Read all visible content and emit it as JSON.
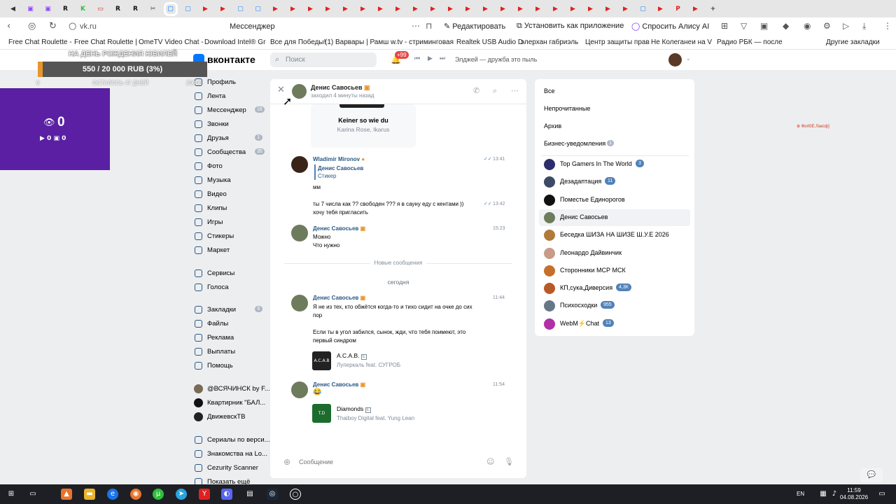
{
  "browser": {
    "tab_icons": [
      {
        "name": "back-tab-icon",
        "glyph": "◀",
        "color": "#333333"
      },
      {
        "name": "twitch-tab-icon",
        "glyph": "▣",
        "color": "#9146ff"
      },
      {
        "name": "twitch-tab-icon",
        "glyph": "▣",
        "color": "#9146ff"
      },
      {
        "name": "r-tab-icon",
        "glyph": "R",
        "color": "#111111"
      },
      {
        "name": "kick-tab-icon",
        "glyph": "K",
        "color": "#2fbf3c"
      },
      {
        "name": "video-tab-icon",
        "glyph": "▭",
        "color": "#e02020"
      },
      {
        "name": "r-tab-icon",
        "glyph": "R",
        "color": "#111111"
      },
      {
        "name": "r-tab-icon",
        "glyph": "R",
        "color": "#111111"
      },
      {
        "name": "scissors-tab-icon",
        "glyph": "✂",
        "color": "#444444"
      },
      {
        "name": "vk-tab-icon",
        "glyph": "▢",
        "color": "#0077ff",
        "active": true
      },
      {
        "name": "messenger-tab-icon",
        "glyph": "▢",
        "color": "#2787f5"
      },
      {
        "name": "youtube-tab-icon",
        "glyph": "▶",
        "color": "#e02020"
      },
      {
        "name": "youtube-tab-icon",
        "glyph": "▶",
        "color": "#e02020"
      },
      {
        "name": "messenger-tab-icon",
        "glyph": "▢",
        "color": "#2787f5"
      },
      {
        "name": "messenger-tab-icon",
        "glyph": "▢",
        "color": "#2787f5"
      },
      {
        "name": "youtube-tab-icon",
        "glyph": "▶",
        "color": "#e02020"
      },
      {
        "name": "youtube-tab-icon",
        "glyph": "▶",
        "color": "#e02020"
      },
      {
        "name": "youtube-tab-icon",
        "glyph": "▶",
        "color": "#e02020"
      },
      {
        "name": "youtube-tab-icon",
        "glyph": "▶",
        "color": "#e02020"
      },
      {
        "name": "youtube-tab-icon",
        "glyph": "▶",
        "color": "#e02020"
      },
      {
        "name": "youtube-tab-icon",
        "glyph": "▶",
        "color": "#e02020"
      },
      {
        "name": "youtube-tab-icon",
        "glyph": "▶",
        "color": "#e02020"
      },
      {
        "name": "youtube-tab-icon",
        "glyph": "▶",
        "color": "#e02020"
      },
      {
        "name": "youtube-tab-icon",
        "glyph": "▶",
        "color": "#e02020"
      },
      {
        "name": "youtube-tab-icon",
        "glyph": "▶",
        "color": "#e02020"
      },
      {
        "name": "youtube-tab-icon",
        "glyph": "▶",
        "color": "#e02020"
      },
      {
        "name": "youtube-tab-icon",
        "glyph": "▶",
        "color": "#e02020"
      },
      {
        "name": "youtube-tab-icon",
        "glyph": "▶",
        "color": "#e02020"
      },
      {
        "name": "youtube-tab-icon",
        "glyph": "▶",
        "color": "#e02020"
      },
      {
        "name": "youtube-tab-icon",
        "glyph": "▶",
        "color": "#e02020"
      },
      {
        "name": "youtube-tab-icon",
        "glyph": "▶",
        "color": "#e02020"
      },
      {
        "name": "youtube-tab-icon",
        "glyph": "▶",
        "color": "#e02020"
      },
      {
        "name": "youtube-tab-icon",
        "glyph": "▶",
        "color": "#e02020"
      },
      {
        "name": "youtube-tab-icon",
        "glyph": "▶",
        "color": "#e02020"
      },
      {
        "name": "youtube-tab-icon",
        "glyph": "▶",
        "color": "#e02020"
      },
      {
        "name": "youtube-tab-icon",
        "glyph": "▶",
        "color": "#e02020"
      },
      {
        "name": "messenger-tab-icon",
        "glyph": "▢",
        "color": "#2787f5"
      },
      {
        "name": "youtube-tab-icon",
        "glyph": "▶",
        "color": "#e02020"
      },
      {
        "name": "p-tab-icon",
        "glyph": "P",
        "color": "#e02020"
      },
      {
        "name": "youtube-tab-icon",
        "glyph": "▶",
        "color": "#e02020"
      }
    ],
    "new_tab": "+",
    "url": "vk.ru",
    "page_title": "Мессенджер",
    "edit_label": "Редактировать",
    "install_label": "Установить как приложение",
    "alice_label": "Спросить Алису AI",
    "bookmarks": [
      "Free Chat Roulette -",
      "Free Chat Roulette |",
      "OmeTV Video Chat -",
      "Download Intel® Gr",
      "Все для Победы!",
      "(1) Варвары | Рамш",
      "w.tv - стриминговая",
      "Realtek USB Audio D",
      "элерхан габриэль",
      "Центр защиты прав",
      "Не Колеганеи на V",
      "Радио РБК — после"
    ],
    "other_bookmarks": "Другие закладки"
  },
  "vk": {
    "logo_text": "вконтакте",
    "search_placeholder": "Поиск",
    "notif_badge": "+99",
    "track": "Элджей — дружба это пыль"
  },
  "sidebar": {
    "items": [
      {
        "label": "Профиль",
        "count": ""
      },
      {
        "label": "Лента",
        "count": ""
      },
      {
        "label": "Мессенджер",
        "count": "16"
      },
      {
        "label": "Звонки",
        "count": ""
      },
      {
        "label": "Друзья",
        "count": "1"
      },
      {
        "label": "Сообщества",
        "count": "35"
      },
      {
        "label": "Фото",
        "count": ""
      },
      {
        "label": "Музыка",
        "count": ""
      },
      {
        "label": "Видео",
        "count": ""
      },
      {
        "label": "Клипы",
        "count": ""
      },
      {
        "label": "Игры",
        "count": ""
      },
      {
        "label": "Стикеры",
        "count": ""
      },
      {
        "label": "Маркет",
        "count": ""
      },
      {
        "label": "Сервисы",
        "count": ""
      },
      {
        "label": "Голоса",
        "count": ""
      },
      {
        "label": "Закладки",
        "count": "6"
      },
      {
        "label": "Файлы",
        "count": ""
      },
      {
        "label": "Реклама",
        "count": ""
      },
      {
        "label": "Выплаты",
        "count": ""
      },
      {
        "label": "Помощь",
        "count": ""
      }
    ],
    "groups": [
      {
        "label": "@ВСЯЧИНСК by F...",
        "color": "#7a6a58"
      },
      {
        "label": "Квартирник \"БАЛ...",
        "color": "#111111"
      },
      {
        "label": "ДвижевскТВ",
        "color": "#222222"
      }
    ],
    "apps": [
      {
        "label": "Сериалы по верси..."
      },
      {
        "label": "Знакомства на Lo..."
      },
      {
        "label": "Cezurity Scanner"
      },
      {
        "label": "Показать ещё"
      }
    ]
  },
  "chat": {
    "name": "Денис Савосьев",
    "status": "заходил 4 минуты назад",
    "top_track": {
      "title": "Keiner so wie du",
      "artist": "Karina Rose, Ikarus"
    },
    "wladimir": {
      "name": "Wladimir Mironov",
      "reply_to": "Денис Савосьев",
      "reply_text": "Стикер",
      "msg1": "мм",
      "time1": "13:41",
      "msg2": "ты 7 числа как ?? свободен ??? я в сауну еду с кентами ))",
      "msg3": "хочу тебя пригласить",
      "time2": "13:42"
    },
    "denis1": {
      "name": "Денис Савосьев",
      "time": "15:23",
      "line1": "Можно",
      "line2": "Что нужно"
    },
    "new_messages": "Новые сообщения",
    "today": "сегодня",
    "denis2": {
      "name": "Денис Савосьев",
      "time": "11:44",
      "p1a": "Я не из тех, кто обжётся когда-то и тихо сидит на очке до сих",
      "p1b": "пор",
      "p2a": "Если ты в угол забился, сынок, жди, что тебя поимеют, это",
      "p2b": "первый синдром",
      "track_title": "A.C.A.B.",
      "track_artist": "Луперкаль feat. СУГРОБ",
      "explicit": "E",
      "cover": "A.C.A.B"
    },
    "denis3": {
      "name": "Денис Савосьев",
      "time": "11:54",
      "emoji": "😂",
      "track_title": "Diamonds",
      "track_artist": "Thaiboy Digital feat. Yung Lean",
      "explicit": "E",
      "cover": "T.D"
    },
    "composer_placeholder": "Сообщение"
  },
  "filters": {
    "all": "Все",
    "unread": "Непрочитанные",
    "archive": "Архив",
    "business": "Бизнес-уведомления",
    "business_count": "1"
  },
  "conversations": [
    {
      "name": "Top Gamers In The World",
      "badge": "3",
      "color": "#2d2d6b"
    },
    {
      "name": "Дезадаптация",
      "badge": "11",
      "color": "#3c4a64"
    },
    {
      "name": "Поместье Единорогов",
      "badge": "",
      "color": "#111111"
    },
    {
      "name": "Денис Савосьев",
      "badge": "",
      "color": "#6e7b5d",
      "active": true
    },
    {
      "name": "Беседка ШИЗА НА ШИЗЕ Ш.У.Е 2026",
      "badge": "",
      "color": "#b07a3a"
    },
    {
      "name": "Леонардо Дайвинчик",
      "badge": "",
      "color": "#c89a8a"
    },
    {
      "name": "Сторонники МСР МСК",
      "badge": "",
      "color": "#c4702a"
    },
    {
      "name": "КП,сука,Диверсия",
      "badge": "4,3К",
      "color": "#b85a28"
    },
    {
      "name": "Психосходки",
      "badge": "955",
      "color": "#667788"
    },
    {
      "name": "WebM⚡Chat",
      "badge": "13",
      "color": "#b030a8"
    }
  ],
  "overlay": {
    "donation_title": "НА ДЕНЬ РОЖДЕНИЯ ЮБИЛЕЙ",
    "donation_label": "550 / 20 000 RUB (3%)",
    "donation_fraction": 0.03,
    "donation_left": "0",
    "donation_days": "ОСТАЛОСЬ 47 ДНЕЙ",
    "donation_right": "20000",
    "viewers": "0",
    "row2": "▶ 0  ▣ 0",
    "side_text": "⊕ Фоrt0E.Лаксф]"
  },
  "taskbar": {
    "lang": "EN",
    "time": "11:59",
    "date": "04.08.2026"
  }
}
